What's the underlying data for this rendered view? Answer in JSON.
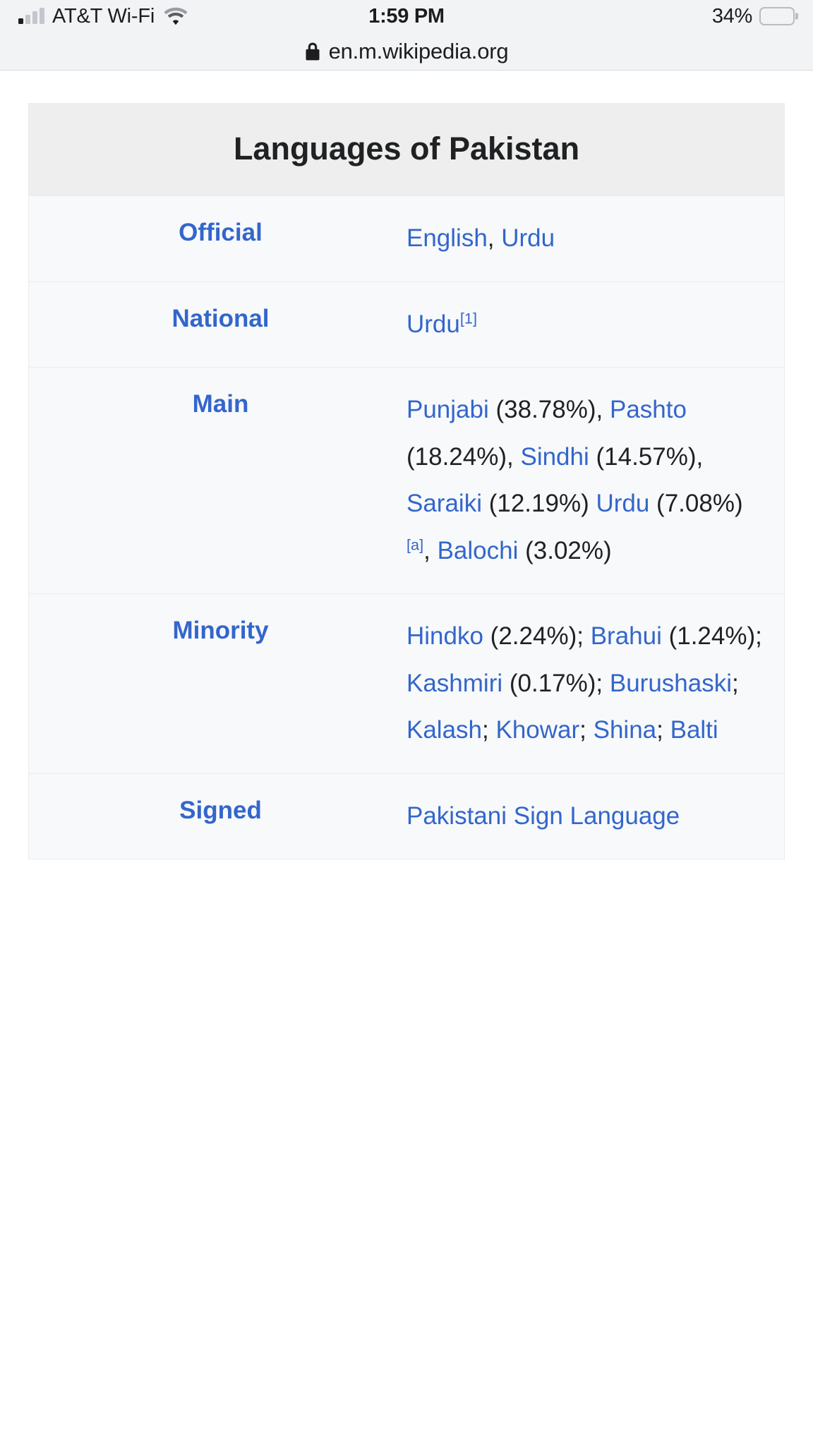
{
  "status_bar": {
    "carrier": "AT&T Wi-Fi",
    "time": "1:59 PM",
    "battery_percent": "34%",
    "battery_level": 34,
    "signal_bars_total": 4,
    "signal_bars_filled": 1,
    "wifi_icon": "wifi-icon",
    "battery_icon": "battery-icon"
  },
  "browser": {
    "lock_icon": "lock-icon",
    "url": "en.m.wikipedia.org"
  },
  "infobox": {
    "title": "Languages of Pakistan",
    "rows": [
      {
        "label": "Official",
        "parts": [
          {
            "type": "link",
            "text": "English"
          },
          {
            "type": "text",
            "text": ", "
          },
          {
            "type": "link",
            "text": "Urdu"
          }
        ]
      },
      {
        "label": "National",
        "parts": [
          {
            "type": "link",
            "text": "Urdu"
          },
          {
            "type": "ref",
            "text": "[1]"
          }
        ]
      },
      {
        "label": "Main",
        "parts": [
          {
            "type": "link",
            "text": "Punjabi"
          },
          {
            "type": "text",
            "text": " (38.78%), "
          },
          {
            "type": "link",
            "text": "Pashto"
          },
          {
            "type": "text",
            "text": " (18.24%), "
          },
          {
            "type": "link",
            "text": "Sindhi"
          },
          {
            "type": "text",
            "text": " (14.57%), "
          },
          {
            "type": "link",
            "text": "Saraiki"
          },
          {
            "type": "text",
            "text": " (12.19%) "
          },
          {
            "type": "link",
            "text": "Urdu"
          },
          {
            "type": "text",
            "text": " (7.08%)"
          },
          {
            "type": "ref",
            "text": "[a]"
          },
          {
            "type": "text",
            "text": ", "
          },
          {
            "type": "link",
            "text": "Balochi"
          },
          {
            "type": "text",
            "text": " (3.02%)"
          }
        ]
      },
      {
        "label": "Minority",
        "parts": [
          {
            "type": "link",
            "text": "Hindko"
          },
          {
            "type": "text",
            "text": " (2.24%); "
          },
          {
            "type": "link",
            "text": "Brahui"
          },
          {
            "type": "text",
            "text": " (1.24%); "
          },
          {
            "type": "link",
            "text": "Kashmiri"
          },
          {
            "type": "text",
            "text": " (0.17%); "
          },
          {
            "type": "link",
            "text": "Burushaski"
          },
          {
            "type": "text",
            "text": "; "
          },
          {
            "type": "link",
            "text": "Kalash"
          },
          {
            "type": "text",
            "text": "; "
          },
          {
            "type": "link",
            "text": "Khowar"
          },
          {
            "type": "text",
            "text": "; "
          },
          {
            "type": "link",
            "text": "Shina"
          },
          {
            "type": "text",
            "text": "; "
          },
          {
            "type": "link",
            "text": "Balti"
          }
        ]
      },
      {
        "label": "Signed",
        "parts": [
          {
            "type": "link",
            "text": "Pakistani Sign Language"
          }
        ]
      }
    ]
  },
  "colors": {
    "link": "#3366cc",
    "text": "#202122",
    "infobox_bg": "#f8f9fa",
    "infobox_title_bg": "#eeeeee",
    "chrome_bg": "#f2f3f5"
  }
}
